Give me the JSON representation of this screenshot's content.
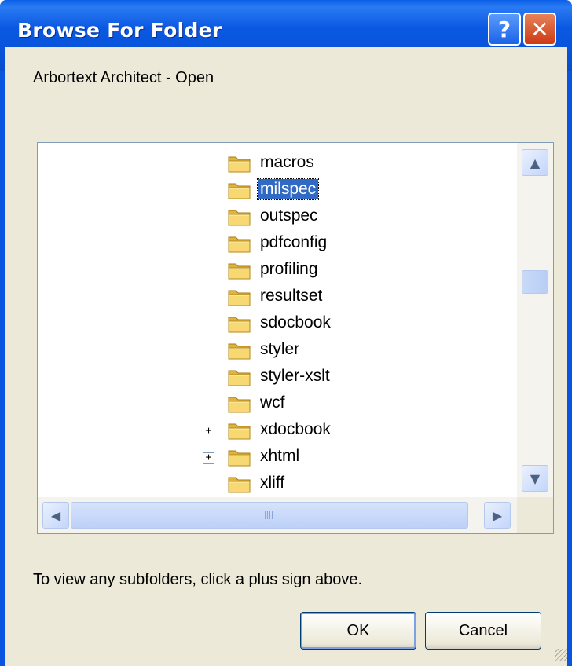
{
  "window": {
    "title": "Browse For Folder",
    "help_glyph": "?",
    "close_glyph": "✕"
  },
  "dialog": {
    "subtitle": "Arbortext Architect - Open",
    "hint": "To view any subfolders, click a plus sign above."
  },
  "tree": {
    "items": [
      {
        "label": "macros",
        "expander": "",
        "selected": false
      },
      {
        "label": "milspec",
        "expander": "",
        "selected": true
      },
      {
        "label": "outspec",
        "expander": "",
        "selected": false
      },
      {
        "label": "pdfconfig",
        "expander": "",
        "selected": false
      },
      {
        "label": "profiling",
        "expander": "",
        "selected": false
      },
      {
        "label": "resultset",
        "expander": "",
        "selected": false
      },
      {
        "label": "sdocbook",
        "expander": "",
        "selected": false
      },
      {
        "label": "styler",
        "expander": "",
        "selected": false
      },
      {
        "label": "styler-xslt",
        "expander": "",
        "selected": false
      },
      {
        "label": "wcf",
        "expander": "",
        "selected": false
      },
      {
        "label": "xdocbook",
        "expander": "+",
        "selected": false
      },
      {
        "label": "xhtml",
        "expander": "+",
        "selected": false
      },
      {
        "label": "xliff",
        "expander": "",
        "selected": false
      }
    ]
  },
  "scroll": {
    "up": "▲",
    "down": "▼",
    "left": "◀",
    "right": "▶"
  },
  "buttons": {
    "ok": "OK",
    "cancel": "Cancel"
  },
  "colors": {
    "titlebar": "#0a58e2",
    "selection": "#316ac5",
    "face": "#ece9d8"
  }
}
